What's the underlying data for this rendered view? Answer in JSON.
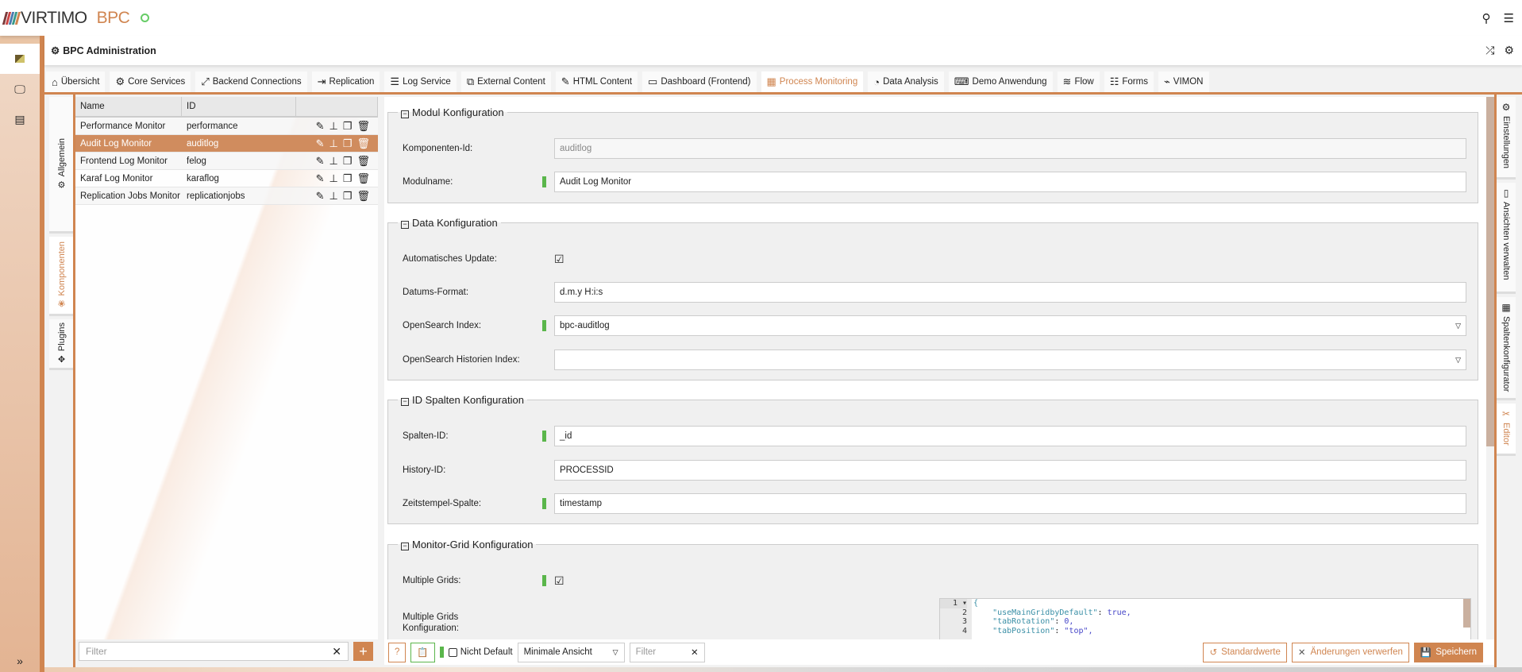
{
  "header": {
    "brand": "VIRTIMO",
    "product": "BPC",
    "status_color": "#66cc66",
    "accent": "#d08550"
  },
  "app": {
    "title": "BPC Administration"
  },
  "tabs": [
    {
      "label": "Übersicht",
      "icon": "⌂"
    },
    {
      "label": "Core Services",
      "icon": "⚙"
    },
    {
      "label": "Backend Connections",
      "icon": "⤢"
    },
    {
      "label": "Replication",
      "icon": "⇥"
    },
    {
      "label": "Log Service",
      "icon": "☰"
    },
    {
      "label": "External Content",
      "icon": "⧉"
    },
    {
      "label": "HTML Content",
      "icon": "✎"
    },
    {
      "label": "Dashboard (Frontend)",
      "icon": "▭"
    },
    {
      "label": "Process Monitoring",
      "icon": "▦",
      "active": true
    },
    {
      "label": "Data Analysis",
      "icon": "◔"
    },
    {
      "label": "Demo Anwendung",
      "icon": "⌨"
    },
    {
      "label": "Flow",
      "icon": "≋"
    },
    {
      "label": "Forms",
      "icon": "☷"
    },
    {
      "label": "VIMON",
      "icon": "⌁"
    }
  ],
  "left_tabs": [
    "Allgemein",
    "Komponenten",
    "Plugins"
  ],
  "grid": {
    "columns": [
      "Name",
      "ID"
    ],
    "rows": [
      {
        "name": "Performance Monitor",
        "id": "performance"
      },
      {
        "name": "Audit Log Monitor",
        "id": "auditlog"
      },
      {
        "name": "Frontend Log Monitor",
        "id": "felog"
      },
      {
        "name": "Karaf Log Monitor",
        "id": "karaflog"
      },
      {
        "name": "Replication Jobs Monitor",
        "id": "replicationjobs"
      }
    ],
    "filter_placeholder": "Filter",
    "add": "+"
  },
  "form": {
    "modul": {
      "legend": "Modul Konfiguration",
      "komp_label": "Komponenten-Id:",
      "komp_value": "auditlog",
      "name_label": "Modulname:",
      "name_value": "Audit Log Monitor"
    },
    "data": {
      "legend": "Data Konfiguration",
      "auto_label": "Automatisches Update:",
      "date_label": "Datums-Format:",
      "date_value": "d.m.y H:i:s",
      "index_label": "OpenSearch Index:",
      "index_value": "bpc-auditlog",
      "hist_label": "OpenSearch Historien Index:",
      "hist_value": ""
    },
    "id": {
      "legend": "ID Spalten Konfiguration",
      "col_label": "Spalten-ID:",
      "col_value": "_id",
      "hist_label": "History-ID:",
      "hist_value": "PROCESSID",
      "ts_label": "Zeitstempel-Spalte:",
      "ts_value": "timestamp"
    },
    "grid": {
      "legend": "Monitor-Grid Konfiguration",
      "multi_label": "Multiple Grids:",
      "conf_label": "Multiple Grids Konfiguration:",
      "code": [
        {
          "n": "1 ▾",
          "k": "{",
          "v": ""
        },
        {
          "n": "2",
          "k": "    \"useMainGridbyDefault\"",
          "v": "true,"
        },
        {
          "n": "3",
          "k": "    \"tabRotation\"",
          "v": "0,"
        },
        {
          "n": "4",
          "k": "    \"tabPosition\"",
          "v": "\"top\","
        }
      ]
    }
  },
  "right_tabs": [
    "Einstellungen",
    "Ansichten verwalten",
    "Spaltenkonfigurator",
    "Editor"
  ],
  "bottom": {
    "not_default": "Nicht Default",
    "view": "Minimale Ansicht",
    "filter_placeholder": "Filter",
    "defaults": "Standardwerte",
    "discard": "Änderungen verwerfen",
    "save": "Speichern"
  }
}
